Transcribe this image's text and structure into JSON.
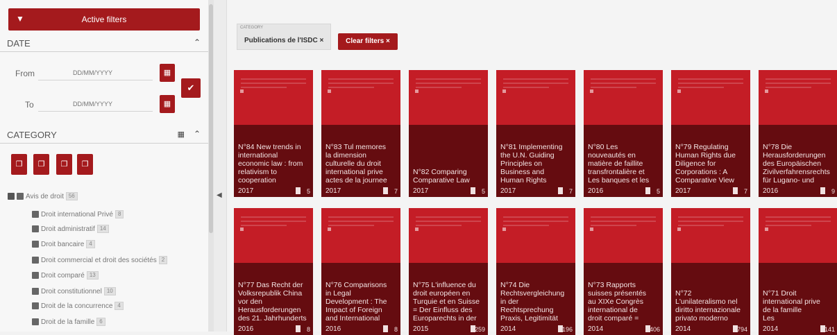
{
  "sidebar": {
    "active_filters_label": "Active filters",
    "date": {
      "title": "DATE",
      "from_label": "From",
      "to_label": "To",
      "from_placeholder": "DD/MM/YYYY",
      "to_placeholder": "DD/MM/YYYY"
    },
    "category": {
      "title": "CATEGORY",
      "root": {
        "label": "Avis de droit",
        "count": "56"
      },
      "items": [
        {
          "label": "Droit international Privé",
          "count": "8"
        },
        {
          "label": "Droit administratif",
          "count": "14"
        },
        {
          "label": "Droit bancaire",
          "count": "4"
        },
        {
          "label": "Droit commercial et droit des sociétés",
          "count": "2"
        },
        {
          "label": "Droit comparé",
          "count": "13"
        },
        {
          "label": "Droit constitutionnel",
          "count": "10"
        },
        {
          "label": "Droit de la concurrence",
          "count": "4"
        },
        {
          "label": "Droit de la famille",
          "count": "6"
        }
      ]
    }
  },
  "filters": {
    "chip_title": "CATEGORY",
    "chip_value": "Publications de l'ISDC ×",
    "clear_label": "Clear filters ×"
  },
  "cards": [
    {
      "title": "N°84 New trends in\ninternational\neconomic law : from\nrelativism to\ncooperation",
      "year": "2017",
      "count": "5"
    },
    {
      "title": "N°83 Tul memores\nla dimension\nculturelle du droit\ninternational prive\nactes de la journee",
      "year": "2017",
      "count": "7"
    },
    {
      "title": "N°82 Comparing\nComparative Law",
      "year": "2017",
      "count": "5"
    },
    {
      "title": "N°81 Implementing\nthe U.N. Guiding\nPrinciples on\nBusiness and\nHuman Rights",
      "year": "2017",
      "count": "7"
    },
    {
      "title": "N°80 Les\nnouveautés en\nmatière de faillite\ntransfrontalière et\nLes banques et les",
      "year": "2016",
      "count": "5"
    },
    {
      "title": "N°79 Regulating\nHuman Rights due\nDiligence for\nCorporations : A\nComparative View",
      "year": "2017",
      "count": "7"
    },
    {
      "title": "N°78 Die\nHerausforderungen\ndes Europäischen\nZivilverfahrensrechts\nfür Lugano- und",
      "year": "2016",
      "count": "9"
    },
    {
      "title": "N°77 Das Recht der\nVolksrepublik China\nvor den\nHerausforderungen\ndes 21. Jahrhunderts",
      "year": "2016",
      "count": "8"
    },
    {
      "title": "N°76 Comparisons\nin Legal\nDevelopment : The\nImpact of Foreign\nand International",
      "year": "2016",
      "count": "8"
    },
    {
      "title": "N°75 L'influence du\ndroit européen en\nTurquie et en Suisse\n= Der Einfluss des\nEuroparechts in der",
      "year": "2015",
      "count": "259"
    },
    {
      "title": "N°74 Die\nRechtsvergleichung\nin der\nRechtsprechung\nPraxis, Legitimität",
      "year": "2014",
      "count": "196"
    },
    {
      "title": "N°73 Rapports\nsuisses présentés\nau XIXe Congrès\ninternational de\ndroit comparé =",
      "year": "2014",
      "count": "406"
    },
    {
      "title": "N°72\nL'unilateralismo nel\ndiritto internazionale\nprivato moderno",
      "year": "2014",
      "count": "794"
    },
    {
      "title": "N°71 Droit\ninternational prive\nde la famille\nLes",
      "year": "2014",
      "count": "141"
    }
  ],
  "colors": {
    "accent": "#a41a1d",
    "card": "#c41d26",
    "card_overlay": "#650c10"
  }
}
